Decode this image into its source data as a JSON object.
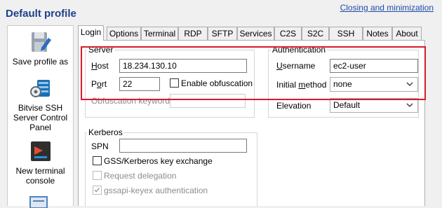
{
  "window": {
    "title": "Default profile",
    "top_link": "Closing and minimization"
  },
  "sidebar": {
    "items": [
      {
        "label": "Save profile as",
        "icon": "save-profile-icon"
      },
      {
        "label": "Bitvise SSH Server Control Panel",
        "icon": "server-control-panel-icon"
      },
      {
        "label": "New terminal console",
        "icon": "terminal-console-icon"
      }
    ]
  },
  "tabs": [
    "Login",
    "Options",
    "Terminal",
    "RDP",
    "SFTP",
    "Services",
    "C2S",
    "S2C",
    "SSH",
    "Notes",
    "About"
  ],
  "active_tab": "Login",
  "server": {
    "group_label": "Server",
    "host_label": "Host",
    "host_value": "18.234.130.10",
    "port_label": "Port",
    "port_value": "22",
    "obfuscation_label": "Enable obfuscation",
    "obfuscation_checked": false,
    "obf_keyword_label": "Obfuscation keyword",
    "obf_keyword_value": ""
  },
  "authentication": {
    "group_label": "Authentication",
    "username_label": "Username",
    "username_value": "ec2-user",
    "method_label": "Initial method",
    "method_value": "none",
    "elevation_label": "Elevation",
    "elevation_value": "Default"
  },
  "kerberos": {
    "group_label": "Kerberos",
    "spn_label": "SPN",
    "spn_value": "",
    "gss_label": "GSS/Kerberos key exchange",
    "gss_checked": false,
    "delegation_label": "Request delegation",
    "delegation_checked": false,
    "keyex_auth_label": "gssapi-keyex authentication",
    "keyex_auth_checked": true
  },
  "colors": {
    "title": "#1e3f8a",
    "link": "#1f4aa8",
    "highlight": "#d81b2c",
    "accent": "#2b6cc4"
  }
}
